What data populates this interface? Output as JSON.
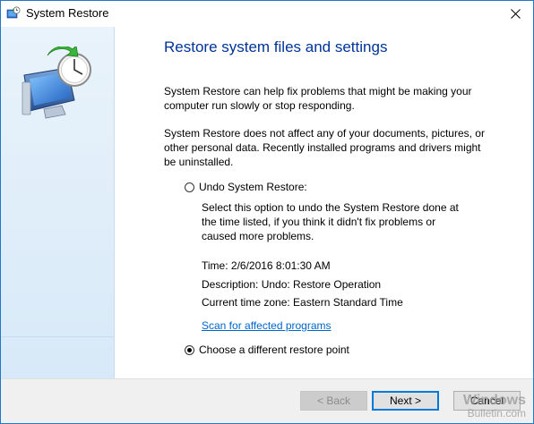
{
  "window": {
    "title": "System Restore"
  },
  "main": {
    "heading": "Restore system files and settings",
    "para1": "System Restore can help fix problems that might be making your computer run slowly or stop responding.",
    "para2": "System Restore does not affect any of your documents, pictures, or other personal data. Recently installed programs and drivers might be uninstalled.",
    "undo_option": {
      "label": "Undo System Restore:",
      "selected": false,
      "description": "Select this option to undo the System Restore done at the time listed, if you think it didn't fix problems or caused more problems.",
      "time": "Time: 2/6/2016 8:01:30 AM",
      "restore_description": "Description: Undo: Restore Operation",
      "timezone": "Current time zone: Eastern Standard Time",
      "scan_link": "Scan for affected programs"
    },
    "different_option": {
      "label": "Choose a different restore point",
      "selected": true
    }
  },
  "footer": {
    "back_label": "< Back",
    "next_label": "Next >",
    "cancel_label": "Cancel"
  },
  "watermark": {
    "line1": "Windows",
    "line2": "Bulletin.com"
  },
  "colors": {
    "heading": "#003399",
    "link": "#0066cc",
    "sidebar": "#dbeaf7",
    "border": "#1f78c8"
  }
}
